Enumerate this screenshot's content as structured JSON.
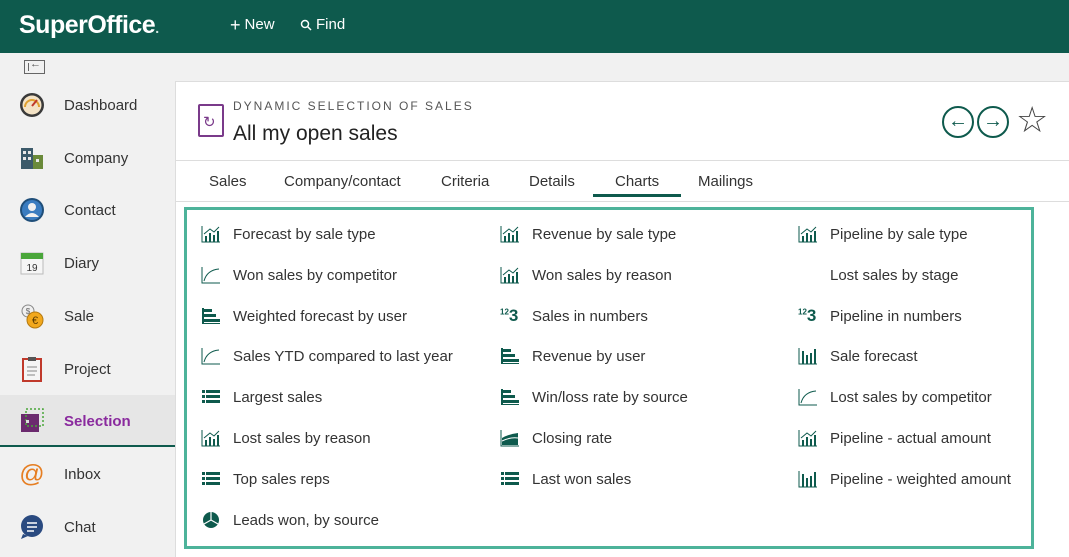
{
  "app": {
    "name": "SuperOffice",
    "name_dot": "."
  },
  "topbar": {
    "new_label": "New",
    "find_label": "Find"
  },
  "sidebar": {
    "items": [
      {
        "label": "Dashboard",
        "icon": "dashboard-icon"
      },
      {
        "label": "Company",
        "icon": "company-icon"
      },
      {
        "label": "Contact",
        "icon": "contact-icon"
      },
      {
        "label": "Diary",
        "icon": "diary-icon",
        "icon_text": "19"
      },
      {
        "label": "Sale",
        "icon": "sale-icon"
      },
      {
        "label": "Project",
        "icon": "project-icon"
      },
      {
        "label": "Selection",
        "icon": "selection-icon",
        "active": true
      },
      {
        "label": "Inbox",
        "icon": "inbox-icon"
      },
      {
        "label": "Chat",
        "icon": "chat-icon"
      }
    ]
  },
  "header": {
    "subtitle": "DYNAMIC SELECTION OF SALES",
    "title": "All my open sales"
  },
  "tabs": [
    {
      "label": "Sales"
    },
    {
      "label": "Company/contact"
    },
    {
      "label": "Criteria"
    },
    {
      "label": "Details"
    },
    {
      "label": "Charts",
      "active": true
    },
    {
      "label": "Mailings"
    }
  ],
  "charts": {
    "col1": [
      {
        "label": "Forecast by sale type",
        "icon": "bar-trend-icon"
      },
      {
        "label": "Won sales by competitor",
        "icon": "line-chart-icon"
      },
      {
        "label": "Weighted forecast by user",
        "icon": "horizontal-bar-icon"
      },
      {
        "label": "Sales YTD compared to last year",
        "icon": "line-chart-icon"
      },
      {
        "label": "Largest sales",
        "icon": "table-icon"
      },
      {
        "label": "Lost sales by reason",
        "icon": "bar-trend-icon"
      },
      {
        "label": "Top sales reps",
        "icon": "table-icon"
      },
      {
        "label": "Leads won, by source",
        "icon": "pie-chart-icon"
      }
    ],
    "col2": [
      {
        "label": "Revenue by sale type",
        "icon": "bar-trend-icon"
      },
      {
        "label": "Won sales by reason",
        "icon": "bar-trend-icon"
      },
      {
        "label": "Sales in numbers",
        "icon": "numbers-icon"
      },
      {
        "label": "Revenue by user",
        "icon": "horizontal-bar-icon"
      },
      {
        "label": "Win/loss rate by source",
        "icon": "horizontal-bar-icon"
      },
      {
        "label": "Closing rate",
        "icon": "area-chart-icon"
      },
      {
        "label": "Last won sales",
        "icon": "table-icon"
      }
    ],
    "col3": [
      {
        "label": "Pipeline by sale type",
        "icon": "bar-trend-icon"
      },
      {
        "label": "Lost sales by stage",
        "icon": "none"
      },
      {
        "label": "Pipeline in numbers",
        "icon": "numbers-icon"
      },
      {
        "label": "Sale forecast",
        "icon": "column-chart-icon"
      },
      {
        "label": "Lost sales by competitor",
        "icon": "line-chart-icon"
      },
      {
        "label": "Pipeline - actual amount",
        "icon": "bar-trend-icon"
      },
      {
        "label": "Pipeline - weighted amount",
        "icon": "column-chart-icon"
      }
    ],
    "numbers_icon_text": {
      "sup": "12",
      "main": "3"
    }
  },
  "colors": {
    "brand": "#0e5a4d",
    "accent_box": "#4db39a",
    "selection": "#8a2a9e"
  }
}
